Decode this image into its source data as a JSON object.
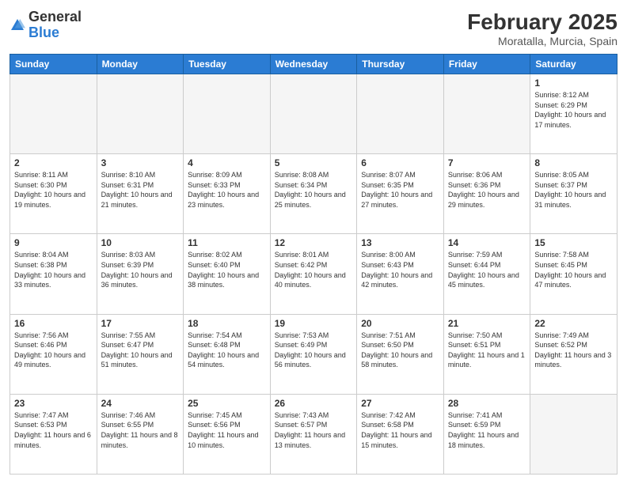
{
  "logo": {
    "general": "General",
    "blue": "Blue"
  },
  "header": {
    "title": "February 2025",
    "location": "Moratalla, Murcia, Spain"
  },
  "weekdays": [
    "Sunday",
    "Monday",
    "Tuesday",
    "Wednesday",
    "Thursday",
    "Friday",
    "Saturday"
  ],
  "weeks": [
    [
      {
        "day": "",
        "info": ""
      },
      {
        "day": "",
        "info": ""
      },
      {
        "day": "",
        "info": ""
      },
      {
        "day": "",
        "info": ""
      },
      {
        "day": "",
        "info": ""
      },
      {
        "day": "",
        "info": ""
      },
      {
        "day": "1",
        "info": "Sunrise: 8:12 AM\nSunset: 6:29 PM\nDaylight: 10 hours and 17 minutes."
      }
    ],
    [
      {
        "day": "2",
        "info": "Sunrise: 8:11 AM\nSunset: 6:30 PM\nDaylight: 10 hours and 19 minutes."
      },
      {
        "day": "3",
        "info": "Sunrise: 8:10 AM\nSunset: 6:31 PM\nDaylight: 10 hours and 21 minutes."
      },
      {
        "day": "4",
        "info": "Sunrise: 8:09 AM\nSunset: 6:33 PM\nDaylight: 10 hours and 23 minutes."
      },
      {
        "day": "5",
        "info": "Sunrise: 8:08 AM\nSunset: 6:34 PM\nDaylight: 10 hours and 25 minutes."
      },
      {
        "day": "6",
        "info": "Sunrise: 8:07 AM\nSunset: 6:35 PM\nDaylight: 10 hours and 27 minutes."
      },
      {
        "day": "7",
        "info": "Sunrise: 8:06 AM\nSunset: 6:36 PM\nDaylight: 10 hours and 29 minutes."
      },
      {
        "day": "8",
        "info": "Sunrise: 8:05 AM\nSunset: 6:37 PM\nDaylight: 10 hours and 31 minutes."
      }
    ],
    [
      {
        "day": "9",
        "info": "Sunrise: 8:04 AM\nSunset: 6:38 PM\nDaylight: 10 hours and 33 minutes."
      },
      {
        "day": "10",
        "info": "Sunrise: 8:03 AM\nSunset: 6:39 PM\nDaylight: 10 hours and 36 minutes."
      },
      {
        "day": "11",
        "info": "Sunrise: 8:02 AM\nSunset: 6:40 PM\nDaylight: 10 hours and 38 minutes."
      },
      {
        "day": "12",
        "info": "Sunrise: 8:01 AM\nSunset: 6:42 PM\nDaylight: 10 hours and 40 minutes."
      },
      {
        "day": "13",
        "info": "Sunrise: 8:00 AM\nSunset: 6:43 PM\nDaylight: 10 hours and 42 minutes."
      },
      {
        "day": "14",
        "info": "Sunrise: 7:59 AM\nSunset: 6:44 PM\nDaylight: 10 hours and 45 minutes."
      },
      {
        "day": "15",
        "info": "Sunrise: 7:58 AM\nSunset: 6:45 PM\nDaylight: 10 hours and 47 minutes."
      }
    ],
    [
      {
        "day": "16",
        "info": "Sunrise: 7:56 AM\nSunset: 6:46 PM\nDaylight: 10 hours and 49 minutes."
      },
      {
        "day": "17",
        "info": "Sunrise: 7:55 AM\nSunset: 6:47 PM\nDaylight: 10 hours and 51 minutes."
      },
      {
        "day": "18",
        "info": "Sunrise: 7:54 AM\nSunset: 6:48 PM\nDaylight: 10 hours and 54 minutes."
      },
      {
        "day": "19",
        "info": "Sunrise: 7:53 AM\nSunset: 6:49 PM\nDaylight: 10 hours and 56 minutes."
      },
      {
        "day": "20",
        "info": "Sunrise: 7:51 AM\nSunset: 6:50 PM\nDaylight: 10 hours and 58 minutes."
      },
      {
        "day": "21",
        "info": "Sunrise: 7:50 AM\nSunset: 6:51 PM\nDaylight: 11 hours and 1 minute."
      },
      {
        "day": "22",
        "info": "Sunrise: 7:49 AM\nSunset: 6:52 PM\nDaylight: 11 hours and 3 minutes."
      }
    ],
    [
      {
        "day": "23",
        "info": "Sunrise: 7:47 AM\nSunset: 6:53 PM\nDaylight: 11 hours and 6 minutes."
      },
      {
        "day": "24",
        "info": "Sunrise: 7:46 AM\nSunset: 6:55 PM\nDaylight: 11 hours and 8 minutes."
      },
      {
        "day": "25",
        "info": "Sunrise: 7:45 AM\nSunset: 6:56 PM\nDaylight: 11 hours and 10 minutes."
      },
      {
        "day": "26",
        "info": "Sunrise: 7:43 AM\nSunset: 6:57 PM\nDaylight: 11 hours and 13 minutes."
      },
      {
        "day": "27",
        "info": "Sunrise: 7:42 AM\nSunset: 6:58 PM\nDaylight: 11 hours and 15 minutes."
      },
      {
        "day": "28",
        "info": "Sunrise: 7:41 AM\nSunset: 6:59 PM\nDaylight: 11 hours and 18 minutes."
      },
      {
        "day": "",
        "info": ""
      }
    ]
  ]
}
